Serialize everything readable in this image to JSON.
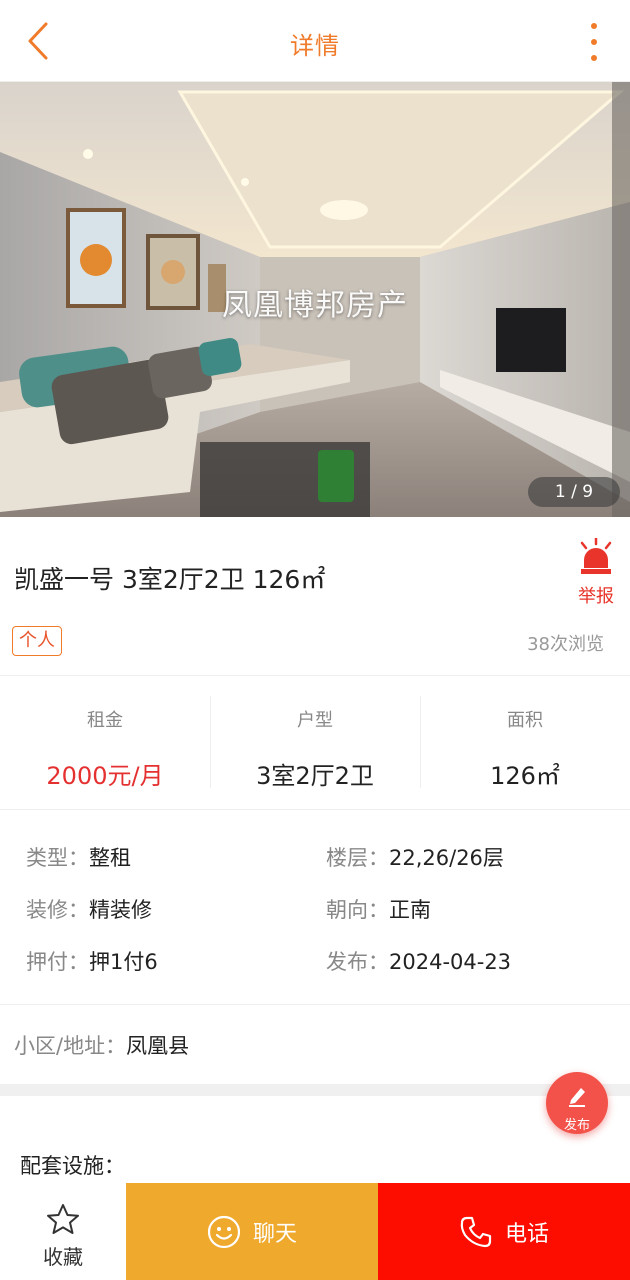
{
  "header": {
    "title": "详情",
    "back_icon": "chevron-left-icon",
    "more_icon": "more-vertical-icon",
    "accent_color": "#f07b2b"
  },
  "gallery": {
    "watermark": "凤凰博邦房产",
    "current": "1",
    "separator": " / ",
    "total": "9"
  },
  "listing": {
    "title": "凯盛一号 3室2厅2卫 126㎡",
    "tag": "个人",
    "views": "38次浏览",
    "report_label": "举报",
    "report_icon": "alarm-siren-icon"
  },
  "stats": [
    {
      "label": "租金",
      "value": "2000元/月"
    },
    {
      "label": "户型",
      "value": "3室2厅2卫"
    },
    {
      "label": "面积",
      "value": "126㎡"
    }
  ],
  "details": {
    "rows": [
      [
        {
          "key": "类型：",
          "value": "整租"
        },
        {
          "key": "楼层：",
          "value": "22,26/26层"
        }
      ],
      [
        {
          "key": "装修：",
          "value": "精装修"
        },
        {
          "key": "朝向：",
          "value": "正南"
        }
      ],
      [
        {
          "key": "押付：",
          "value": "押1付6"
        },
        {
          "key": "发布：",
          "value": "2024-04-23"
        }
      ]
    ],
    "address_key": "小区/地址：",
    "address_value": "凤凰县"
  },
  "facilities_label": "配套设施：",
  "fab": {
    "label": "发布",
    "icon": "pencil-icon"
  },
  "bottom_bar": {
    "favorite_label": "收藏",
    "favorite_icon": "star-outline-icon",
    "chat_label": "聊天",
    "chat_icon": "smiley-icon",
    "call_label": "电话",
    "call_icon": "phone-icon"
  },
  "colors": {
    "price": "#e53030",
    "chat_bg": "#efa92d",
    "call_bg": "#fc0d00",
    "fab_bg": "#f2524a"
  }
}
